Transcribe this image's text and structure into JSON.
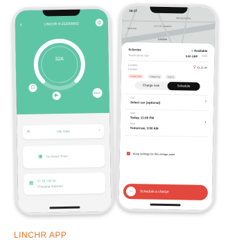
{
  "left_phone": {
    "header_title": "LINCHR H-222009002",
    "current": "32A",
    "fast_label": "FAST",
    "status_text": "Idle State",
    "timer_text": "No Boost Timer",
    "session_date": "07-16 ~08-16",
    "session_label": "Charging Statistics",
    "accent": "#5fc6a5"
  },
  "right_phone": {
    "status_time": "16:17",
    "map_labels": [
      "WHITECHAPEL",
      "CITY OF LONDON",
      "MAYFAIR",
      "London"
    ],
    "series_name": "N-Series",
    "availability": "Available",
    "station_name": "Teach demo Sun",
    "price": "0.60 GBP",
    "price_unit": "/kWh",
    "city_line_1": "London",
    "city_line_2": "London",
    "distance": "11.11 mi",
    "tags": [
      "Private Park",
      "Charge Ing",
      "Type 2"
    ],
    "tab_charge_now": "Charge now",
    "tab_schedule": "Schedule",
    "car_label": "Car",
    "car_value": "Select car (optional)",
    "start_label": "Start",
    "start_value": "Today, 11:00 PM",
    "stop_label": "Stop",
    "stop_value": "Tomorrow, 3:00 AM",
    "keep_settings": "Keep settings for this charge point",
    "schedule_button": "Schedule a charge",
    "accent": "#e2483d"
  },
  "brand": "LINCHR APP"
}
